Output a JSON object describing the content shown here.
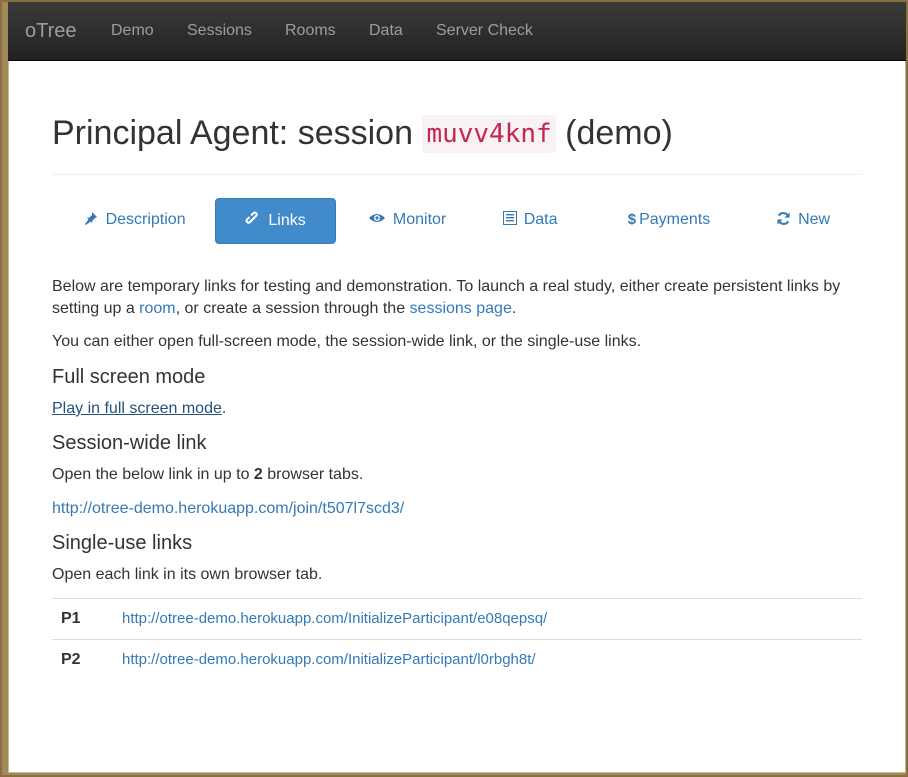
{
  "navbar": {
    "brand": "oTree",
    "items": [
      "Demo",
      "Sessions",
      "Rooms",
      "Data",
      "Server Check"
    ]
  },
  "page": {
    "title_prefix": "Principal Agent: session",
    "session_code": "muvv4knf",
    "title_suffix": "(demo)"
  },
  "tabs": [
    {
      "label": "Description",
      "icon": "pushpin-icon"
    },
    {
      "label": "Links",
      "icon": "link-icon"
    },
    {
      "label": "Monitor",
      "icon": "eye-icon"
    },
    {
      "label": "Data",
      "icon": "list-alt-icon"
    },
    {
      "label": "Payments",
      "icon": "dollar-icon"
    },
    {
      "label": "New",
      "icon": "refresh-icon"
    }
  ],
  "intro": {
    "part1": "Below are temporary links for testing and demonstration. To launch a real study, either create persistent links by setting up a ",
    "room_link": "room",
    "part2": ", or create a session through the ",
    "sessions_link": "sessions page",
    "part3": "."
  },
  "intro2": "You can either open full-screen mode, the session-wide link, or the single-use links.",
  "fullscreen": {
    "heading": "Full screen mode",
    "link": "Play in full screen mode",
    "after": "."
  },
  "session_wide": {
    "heading": "Session-wide link",
    "text_before": "Open the below link in up to ",
    "count": "2",
    "text_after": " browser tabs.",
    "url": "http://otree-demo.herokuapp.com/join/t507l7scd3/"
  },
  "single_use": {
    "heading": "Single-use links",
    "text": "Open each link in its own browser tab.",
    "rows": [
      {
        "id": "P1",
        "url": "http://otree-demo.herokuapp.com/InitializeParticipant/e08qepsq/"
      },
      {
        "id": "P2",
        "url": "http://otree-demo.herokuapp.com/InitializeParticipant/l0rbgh8t/"
      }
    ]
  },
  "colors": {
    "link": "#337ab7",
    "active_tab": "#428bca",
    "code_text": "#c7254e",
    "code_bg": "#f9f2f4",
    "navbar_bg": "#222222"
  }
}
